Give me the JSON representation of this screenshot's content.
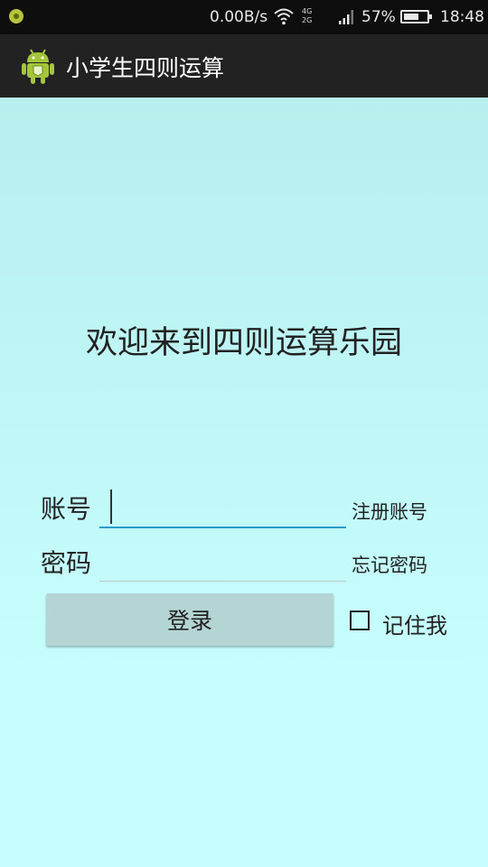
{
  "status_bar": {
    "network_speed": "0.00B/s",
    "network_type_top": "4G",
    "network_type_bottom": "2G",
    "battery_percent": "57%",
    "time": "18:48"
  },
  "action_bar": {
    "app_icon": "android-robot-icon",
    "title": "小学生四则运算"
  },
  "main": {
    "welcome": "欢迎来到四则运算乐园",
    "account_label": "账号",
    "account_value": "",
    "password_label": "密码",
    "password_value": "",
    "register_link": "注册账号",
    "forgot_link": "忘记密码",
    "login_button": "登录",
    "remember_label": "记住我",
    "remember_checked": false
  },
  "colors": {
    "background": "#c6fdfd",
    "action_bar": "#222222",
    "input_focus_underline": "#2b9bc9",
    "button": "#b3d5d4"
  }
}
